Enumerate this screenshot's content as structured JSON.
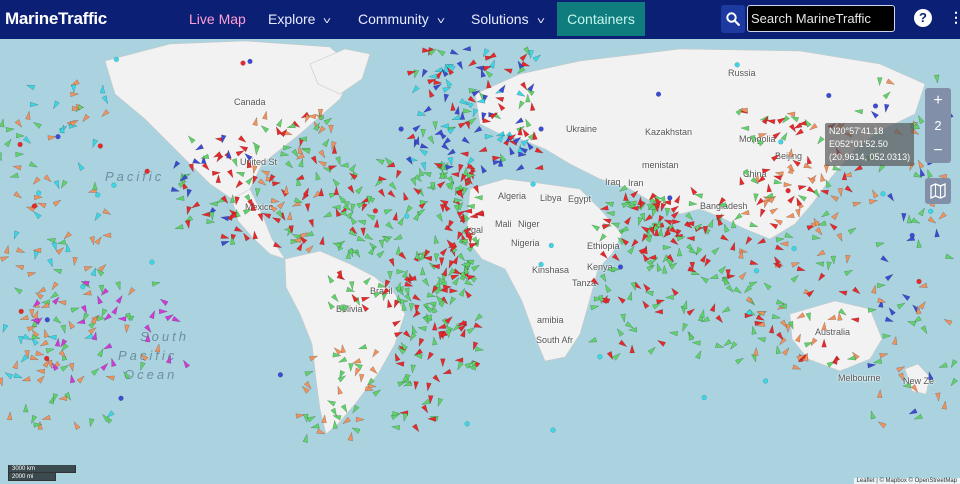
{
  "brand": {
    "name": "MarineTraffic"
  },
  "nav": {
    "live_map": "Live Map",
    "explore": "Explore",
    "community": "Community",
    "solutions": "Solutions",
    "containers": "Containers"
  },
  "search": {
    "placeholder": "Search MarineTraffic"
  },
  "help_label": "?",
  "map": {
    "zoom_in": "+",
    "zoom_level": "2",
    "zoom_out": "−",
    "coords": {
      "lat": "N20°57'41.18",
      "lon": "E052°01'52.50",
      "decimal": "(20.9614, 052.0313)"
    },
    "scale_km": "3000 km",
    "scale_mi": "2000 mi",
    "attribution": "Leaflet | © Mapbox © OpenStreetMap",
    "labels": {
      "canada": "Canada",
      "united_states": "United St",
      "mexico": "Mexico",
      "russia": "Russia",
      "kazakhstan": "Kazakhstan",
      "mongolia": "Mongolia",
      "beijing": "Beijing",
      "china": "China",
      "ukraine": "Ukraine",
      "turkmenistan": "menistan",
      "iraq": "Iraq",
      "iran": "Iran",
      "egypt": "Egypt",
      "libya": "Libya",
      "algeria": "Algeria",
      "mali": "Mali",
      "niger": "Niger",
      "egal": "egal",
      "nigeria": "Nigeria",
      "ethiopia": "Ethiopia",
      "kinshasa": "Kinshasa",
      "kenya": "Kenya",
      "tanza": "Tanza",
      "namibia": "amibia",
      "south_afr": "South Afr",
      "bangladesh": "Bangladesh",
      "brazil": "Brazil",
      "bolivia": "Bolivia",
      "australia": "Australia",
      "melbourne": "Melbourne",
      "new_ze": "New Ze",
      "pacific_1": "Pacific",
      "south": "South",
      "pacific_2": "Pacific",
      "ocean": "Ocean"
    }
  },
  "colors": {
    "header": "#0b1f74",
    "containers_bg": "#0f7d7d",
    "live_map_active": "#ff9fd6",
    "cargo_vessel": "#5fd36a",
    "tanker_vessel": "#e8292b",
    "passenger_vessel": "#3c4bd3",
    "tug_vessel": "#3bd7e6",
    "fishing_vessel": "#f0925e",
    "pleasure_vessel": "#d23ad8",
    "land": "#f2f2f2",
    "water": "#aad3df"
  }
}
